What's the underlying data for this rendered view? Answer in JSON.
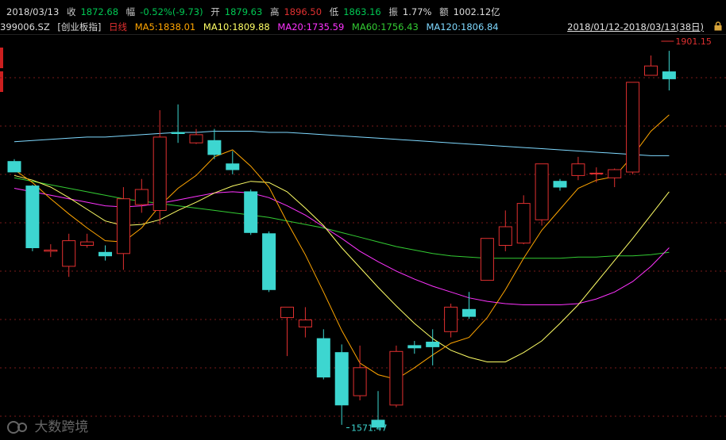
{
  "header": {
    "date": "2018/03/13",
    "close_label": "收",
    "close_value": "1872.68",
    "change_label": "幅",
    "change_value": "-0.52%(-9.73)",
    "open_label": "开",
    "open_value": "1879.63",
    "high_label": "高",
    "high_value": "1896.50",
    "low_label": "低",
    "low_value": "1863.16",
    "amplitude_label": "振",
    "amplitude_value": "1.77%",
    "amount_label": "额",
    "amount_value": "1002.12亿"
  },
  "legend": {
    "code": "399006.SZ",
    "name": "[创业板指]",
    "period": "日线",
    "ma5": "MA5:1838.01",
    "ma10": "MA10:1809.88",
    "ma20": "MA20:1735.59",
    "ma60": "MA60:1756.43",
    "ma120": "MA120:1806.84",
    "range": "2018/01/12-2018/03/13(38日)"
  },
  "colors": {
    "up": "#e03030",
    "down": "#3dd6d0",
    "ma5": "#ffa500",
    "ma10": "#ffff66",
    "ma20": "#ff33ff",
    "ma60": "#33cc33",
    "ma120": "#7fd9ff",
    "grid": "#7a1a1a"
  },
  "watermark": "大数跨境",
  "chart_data": {
    "type": "candlestick",
    "ylim": [
      1565,
      1910
    ],
    "annotations": {
      "high": "1901.15",
      "low": "1571.47"
    },
    "candles": [
      {
        "o": 1802,
        "h": 1804,
        "l": 1793,
        "c": 1793
      },
      {
        "o": 1781,
        "h": 1782,
        "l": 1725,
        "c": 1728
      },
      {
        "o": 1725,
        "h": 1731,
        "l": 1720,
        "c": 1726
      },
      {
        "o": 1712,
        "h": 1740,
        "l": 1703,
        "c": 1734
      },
      {
        "o": 1730,
        "h": 1740,
        "l": 1728,
        "c": 1733
      },
      {
        "o": 1724,
        "h": 1730,
        "l": 1717,
        "c": 1721
      },
      {
        "o": 1723,
        "h": 1780,
        "l": 1709,
        "c": 1770
      },
      {
        "o": 1765,
        "h": 1787,
        "l": 1758,
        "c": 1778
      },
      {
        "o": 1760,
        "h": 1846,
        "l": 1748,
        "c": 1823
      },
      {
        "o": 1827,
        "h": 1851,
        "l": 1818,
        "c": 1826
      },
      {
        "o": 1818,
        "h": 1830,
        "l": 1817,
        "c": 1825
      },
      {
        "o": 1820,
        "h": 1830,
        "l": 1804,
        "c": 1808
      },
      {
        "o": 1800,
        "h": 1811,
        "l": 1791,
        "c": 1795
      },
      {
        "o": 1776,
        "h": 1778,
        "l": 1739,
        "c": 1741
      },
      {
        "o": 1740,
        "h": 1742,
        "l": 1690,
        "c": 1692
      },
      {
        "o": 1668,
        "h": 1676,
        "l": 1635,
        "c": 1677
      },
      {
        "o": 1660,
        "h": 1677,
        "l": 1651,
        "c": 1666
      },
      {
        "o": 1650,
        "h": 1658,
        "l": 1615,
        "c": 1617
      },
      {
        "o": 1638,
        "h": 1645,
        "l": 1576,
        "c": 1593
      },
      {
        "o": 1601,
        "h": 1644,
        "l": 1597,
        "c": 1625
      },
      {
        "o": 1580,
        "h": 1605,
        "l": 1573,
        "c": 1574
      },
      {
        "o": 1593,
        "h": 1644,
        "l": 1591,
        "c": 1639
      },
      {
        "o": 1644,
        "h": 1648,
        "l": 1637,
        "c": 1642
      },
      {
        "o": 1647,
        "h": 1658,
        "l": 1627,
        "c": 1643
      },
      {
        "o": 1656,
        "h": 1680,
        "l": 1651,
        "c": 1677
      },
      {
        "o": 1675,
        "h": 1690,
        "l": 1667,
        "c": 1669
      },
      {
        "o": 1700,
        "h": 1712,
        "l": 1701,
        "c": 1736
      },
      {
        "o": 1730,
        "h": 1760,
        "l": 1725,
        "c": 1746
      },
      {
        "o": 1732,
        "h": 1773,
        "l": 1731,
        "c": 1766
      },
      {
        "o": 1752,
        "h": 1793,
        "l": 1747,
        "c": 1800
      },
      {
        "o": 1785,
        "h": 1787,
        "l": 1777,
        "c": 1780
      },
      {
        "o": 1790,
        "h": 1806,
        "l": 1786,
        "c": 1800
      },
      {
        "o": 1792,
        "h": 1797,
        "l": 1784,
        "c": 1792
      },
      {
        "o": 1788,
        "h": 1796,
        "l": 1780,
        "c": 1795
      },
      {
        "o": 1793,
        "h": 1836,
        "l": 1791,
        "c": 1870
      },
      {
        "o": 1876,
        "h": 1893,
        "l": 1876,
        "c": 1884
      },
      {
        "o": 1879,
        "h": 1897,
        "l": 1863,
        "c": 1873
      }
    ],
    "ma": {
      "ma5": [
        1795,
        1784,
        1770,
        1757,
        1745,
        1734,
        1733,
        1745,
        1764,
        1779,
        1790,
        1806,
        1812,
        1798,
        1780,
        1750,
        1722,
        1690,
        1657,
        1629,
        1619,
        1615,
        1625,
        1636,
        1646,
        1651,
        1668,
        1692,
        1719,
        1743,
        1761,
        1779,
        1786,
        1789,
        1807,
        1828,
        1842
      ],
      "ma10": [
        1790,
        1786,
        1780,
        1771,
        1761,
        1751,
        1747,
        1748,
        1752,
        1760,
        1767,
        1775,
        1781,
        1785,
        1784,
        1776,
        1762,
        1747,
        1728,
        1711,
        1694,
        1678,
        1663,
        1650,
        1640,
        1634,
        1630,
        1630,
        1638,
        1648,
        1663,
        1679,
        1698,
        1717,
        1736,
        1756,
        1776
      ],
      "ma20": [
        1779,
        1776,
        1773,
        1770,
        1767,
        1764,
        1763,
        1764,
        1766,
        1769,
        1772,
        1775,
        1776,
        1775,
        1771,
        1764,
        1756,
        1746,
        1736,
        1725,
        1716,
        1708,
        1701,
        1695,
        1690,
        1685,
        1682,
        1680,
        1679,
        1679,
        1679,
        1680,
        1684,
        1690,
        1699,
        1712,
        1728
      ],
      "ma60": [
        1788,
        1785,
        1782,
        1779,
        1776,
        1773,
        1770,
        1768,
        1766,
        1764,
        1762,
        1760,
        1758,
        1756,
        1754,
        1751,
        1748,
        1745,
        1741,
        1737,
        1733,
        1729,
        1726,
        1723,
        1721,
        1720,
        1719,
        1719,
        1719,
        1719,
        1719,
        1720,
        1720,
        1721,
        1721,
        1722,
        1724
      ],
      "ma120": [
        1819,
        1820,
        1821,
        1822,
        1823,
        1823,
        1824,
        1825,
        1826,
        1827,
        1827,
        1828,
        1828,
        1828,
        1827,
        1827,
        1826,
        1825,
        1824,
        1823,
        1822,
        1821,
        1820,
        1819,
        1818,
        1817,
        1816,
        1815,
        1814,
        1813,
        1812,
        1811,
        1810,
        1809,
        1808,
        1807,
        1807
      ]
    }
  }
}
